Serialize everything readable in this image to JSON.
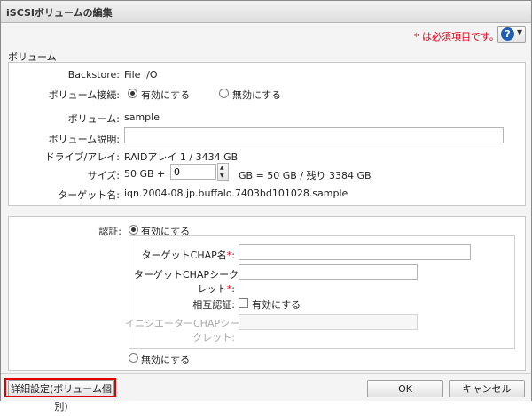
{
  "window": {
    "title": "iSCSIボリュームの編集"
  },
  "header": {
    "required_note": "* は必須項目です。",
    "help_icon_label": "?"
  },
  "volume_section": {
    "label": "ボリューム",
    "backstore_label": "Backstore:",
    "backstore_value": "File I/O",
    "connection_label": "ボリューム接続:",
    "connection_enable": "有効にする",
    "connection_disable": "無効にする",
    "volume_label": "ボリューム:",
    "volume_value": "sample",
    "description_label": "ボリューム説明:",
    "description_value": "",
    "drive_label": "ドライブ/アレイ:",
    "drive_value": "RAIDアレイ 1 / 3434 GB",
    "size_label": "サイズ:",
    "size_prefix": "50 GB +",
    "size_input": "0",
    "size_result": "GB = 50 GB / 残り 3384 GB",
    "target_label": "ターゲット名:",
    "target_value": "iqn.2004-08.jp.buffalo.7403bd101028.sample"
  },
  "auth_section": {
    "auth_label": "認証:",
    "auth_enable": "有効にする",
    "chap_name_label": "ターゲットCHAP名",
    "chap_secret_label_1": "ターゲットCHAPシーク",
    "chap_secret_label_2": "レット",
    "required_mark": "*",
    "colon": ":",
    "mutual_label": "相互認証:",
    "mutual_checkbox_label": "有効にする",
    "initiator_label_1": "イニシエーターCHAPシー",
    "initiator_label_2": "クレット:",
    "auth_disable": "無効にする"
  },
  "footer": {
    "advanced_button": "詳細設定(ボリューム個別)",
    "ok_button": "OK",
    "cancel_button": "キャンセル"
  },
  "colors": {
    "required": "#e0001b",
    "highlight": "#e00000",
    "help_blue": "#1c5fb3"
  }
}
